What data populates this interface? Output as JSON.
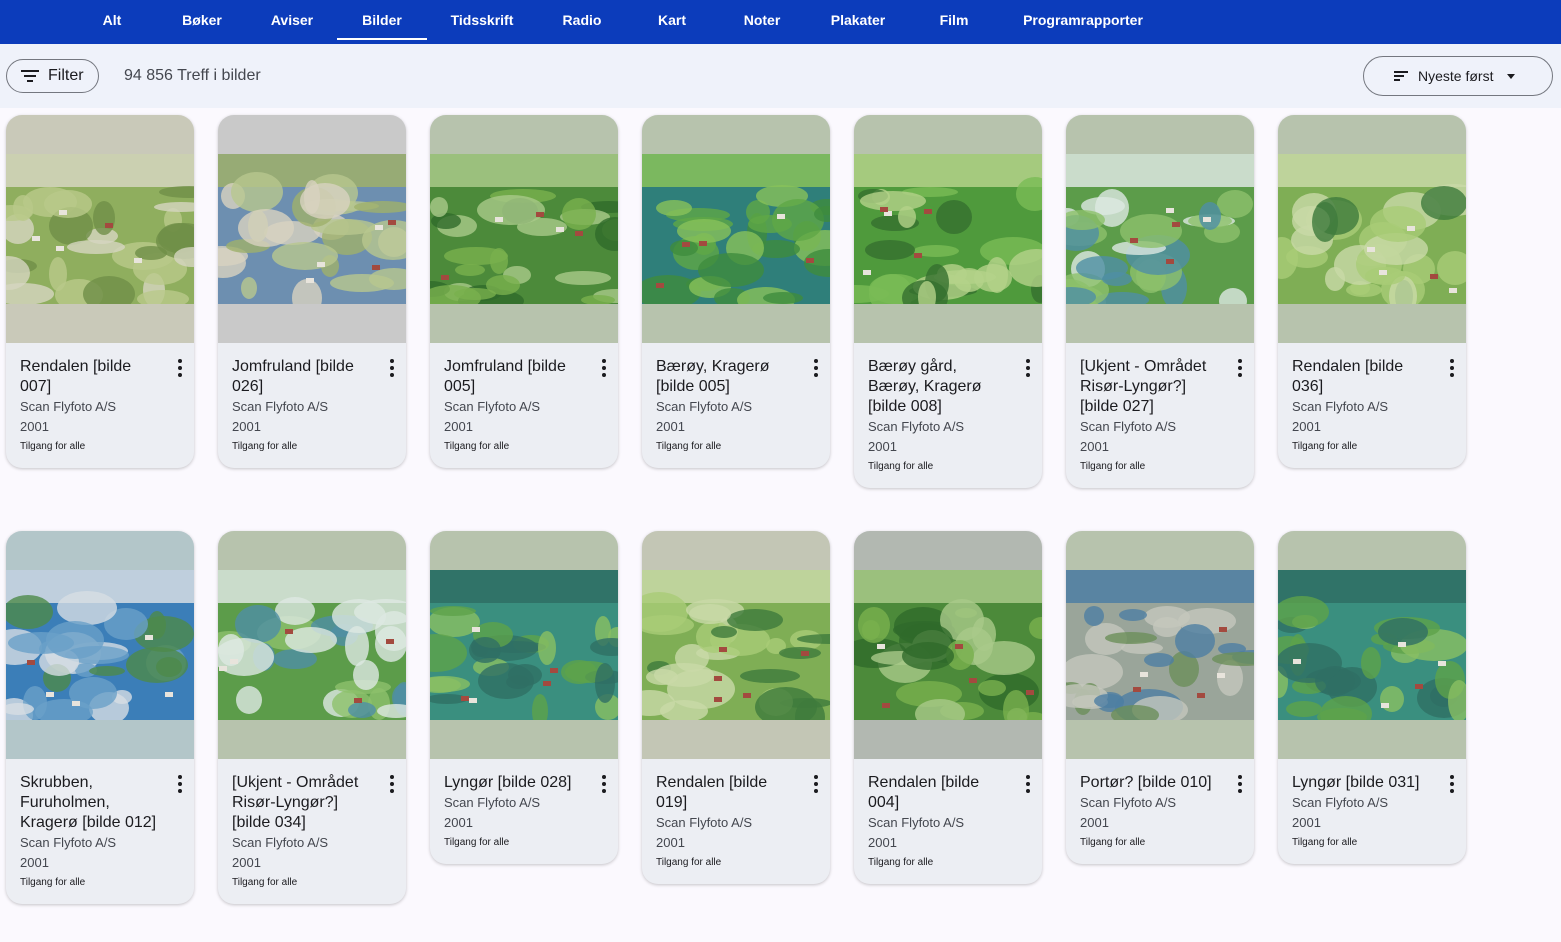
{
  "nav": {
    "tabs": [
      {
        "label": "Alt"
      },
      {
        "label": "Bøker"
      },
      {
        "label": "Aviser"
      },
      {
        "label": "Bilder",
        "active": true
      },
      {
        "label": "Tidsskrift"
      },
      {
        "label": "Radio"
      },
      {
        "label": "Kart"
      },
      {
        "label": "Noter"
      },
      {
        "label": "Plakater"
      },
      {
        "label": "Film"
      },
      {
        "label": "Programrapporter"
      }
    ]
  },
  "toolbar": {
    "filter_label": "Filter",
    "hits": "94 856 Treff i bilder",
    "sort_label": "Nyeste først"
  },
  "results": [
    {
      "title": "Rendalen [bilde 007]",
      "creator": "Scan Flyfoto A/S",
      "year": "2001",
      "access": "Tilgang for alle",
      "frame": "#c9c9b9",
      "scene": "farm"
    },
    {
      "title": "Jomfruland [bilde 026]",
      "creator": "Scan Flyfoto A/S",
      "year": "2001",
      "access": "Tilgang for alle",
      "frame": "#c9c9c9",
      "scene": "coast"
    },
    {
      "title": "Jomfruland [bilde 005]",
      "creator": "Scan Flyfoto A/S",
      "year": "2001",
      "access": "Tilgang for alle",
      "frame": "#b7c3ad",
      "scene": "forest"
    },
    {
      "title": "Bærøy, Kragerø [bilde 005]",
      "creator": "Scan Flyfoto A/S",
      "year": "2001",
      "access": "Tilgang for alle",
      "frame": "#b7c3ad",
      "scene": "lake"
    },
    {
      "title": "Bærøy gård, Bærøy, Kragerø [bilde 008]",
      "creator": "Scan Flyfoto A/S",
      "year": "2001",
      "access": "Tilgang for alle",
      "frame": "#b7c3ad",
      "scene": "hills"
    },
    {
      "title": "[Ukjent - Området Risør-Lyngør?] [bilde 027]",
      "creator": "Scan Flyfoto A/S",
      "year": "2001",
      "access": "Tilgang for alle",
      "frame": "#b7c3ad",
      "scene": "village"
    },
    {
      "title": "Rendalen [bilde 036]",
      "creator": "Scan Flyfoto A/S",
      "year": "2001",
      "access": "Tilgang for alle",
      "frame": "#b7c3ad",
      "scene": "field"
    },
    {
      "title": "Skrubben, Furuholmen, Kragerø [bilde 012]",
      "creator": "Scan Flyfoto A/S",
      "year": "2001",
      "access": "Tilgang for alle",
      "frame": "#b3c6c9",
      "scene": "fjord"
    },
    {
      "title": "[Ukjent - Området Risør-Lyngør?] [bilde 034]",
      "creator": "Scan Flyfoto A/S",
      "year": "2001",
      "access": "Tilgang for alle",
      "frame": "#b7c3ad",
      "scene": "village"
    },
    {
      "title": "Lyngør [bilde 028]",
      "creator": "Scan Flyfoto A/S",
      "year": "2001",
      "access": "Tilgang for alle",
      "frame": "#b7c3ad",
      "scene": "island"
    },
    {
      "title": "Rendalen [bilde 019]",
      "creator": "Scan Flyfoto A/S",
      "year": "2001",
      "access": "Tilgang for alle",
      "frame": "#c3c6b5",
      "scene": "field"
    },
    {
      "title": "Rendalen [bilde 004]",
      "creator": "Scan Flyfoto A/S",
      "year": "2001",
      "access": "Tilgang for alle",
      "frame": "#b2b8b1",
      "scene": "forest"
    },
    {
      "title": "Portør? [bilde 010]",
      "creator": "Scan Flyfoto A/S",
      "year": "2001",
      "access": "Tilgang for alle",
      "frame": "#b7c3ad",
      "scene": "rocks"
    },
    {
      "title": "Lyngør [bilde 031]",
      "creator": "Scan Flyfoto A/S",
      "year": "2001",
      "access": "Tilgang for alle",
      "frame": "#b7c3ad",
      "scene": "island"
    }
  ]
}
